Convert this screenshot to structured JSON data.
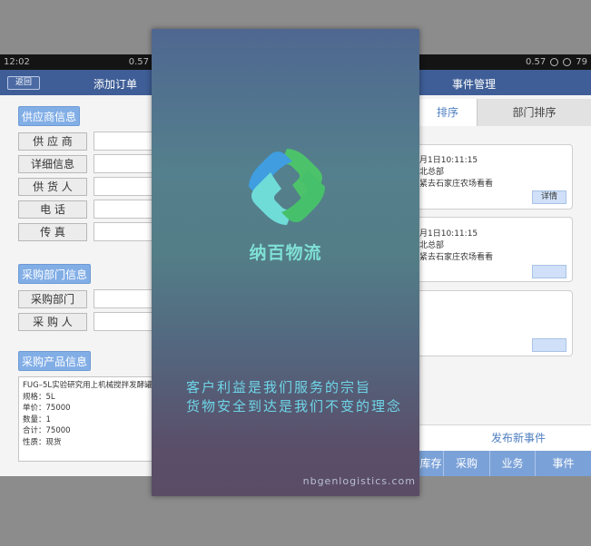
{
  "left_phone": {
    "status": {
      "time": "12:02",
      "battery": "0.57"
    },
    "back_label": "返回",
    "title": "添加订单",
    "supplier": {
      "section_label": "供应商信息",
      "fields": [
        "供 应 商",
        "详细信息",
        "供 货 人",
        "电    话",
        "传    真"
      ]
    },
    "purchase_dept": {
      "section_label": "采购部门信息",
      "fields": [
        "采购部门",
        "采 购 人"
      ]
    },
    "product": {
      "section_label": "采购产品信息",
      "lines": [
        "FUG–5L实验研究用上机械搅拌发酵罐",
        "规格：5L",
        "单价：75000",
        "数量：1",
        "合计：75000",
        "性质：现货"
      ]
    }
  },
  "splash": {
    "brand": "纳百物流",
    "slogan_1": "客户利益是我们服务的宗旨",
    "slogan_2": "货物安全到达是我们不变的理念",
    "website": "nbgenlogistics.com",
    "colors": {
      "logo_green": "#4cc36a",
      "logo_blue": "#3f9de0",
      "logo_cyan": "#6fdcd8"
    }
  },
  "right_phone": {
    "status": {
      "battery_speed": "0.57",
      "battery_level": "79"
    },
    "title": "事件管理",
    "tabs": [
      "排序",
      "部门排序"
    ],
    "cards": [
      {
        "time": "月1日10:11:15",
        "dept": "北总部",
        "text": "紧去石家庄农场看看",
        "button": "详情"
      },
      {
        "time": "月1日10:11:15",
        "dept": "北总部",
        "text": "紧去石家庄农场看看",
        "button": ""
      },
      {
        "time": "",
        "dept": "",
        "text": "",
        "button": ""
      }
    ],
    "publish_label": "发布新事件",
    "nav": [
      "库存",
      "采购",
      "业务",
      "事件"
    ],
    "colors": {
      "titlebar": "#3f5e97",
      "nav": "#7ba2d8",
      "accent": "#4f7fc0"
    }
  }
}
